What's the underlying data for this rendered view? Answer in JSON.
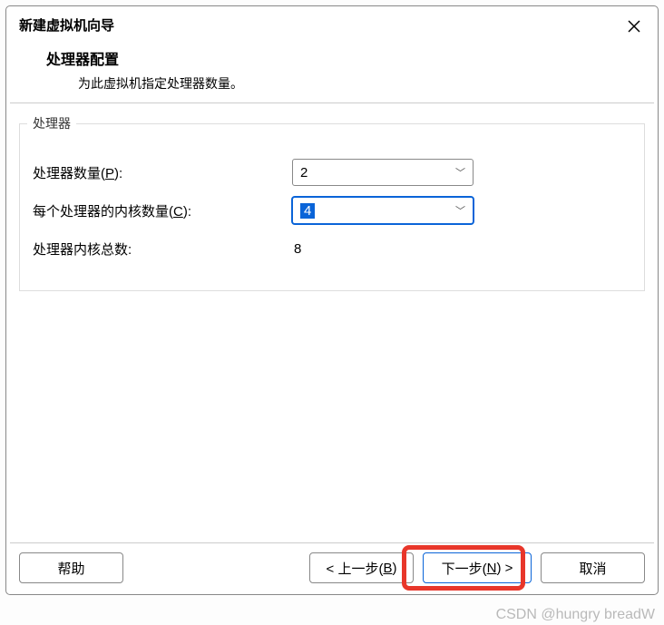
{
  "header": {
    "title": "新建虚拟机向导",
    "section_title": "处理器配置",
    "section_desc": "为此虚拟机指定处理器数量。"
  },
  "group_legend": "处理器",
  "fields": {
    "proc_count": {
      "label_pre": "处理器数量(",
      "mnemonic": "P",
      "label_post": "):",
      "value": "2"
    },
    "cores_per": {
      "label_pre": "每个处理器的内核数量(",
      "mnemonic": "C",
      "label_post": "):",
      "value": "4"
    },
    "total": {
      "label": "处理器内核总数:",
      "value": "8"
    }
  },
  "buttons": {
    "help": "帮助",
    "back_pre": "< 上一步(",
    "back_m": "B",
    "back_post": ")",
    "next_pre": "下一步(",
    "next_m": "N",
    "next_post": ") >",
    "cancel": "取消"
  },
  "watermark": "CSDN @hungry breadW"
}
